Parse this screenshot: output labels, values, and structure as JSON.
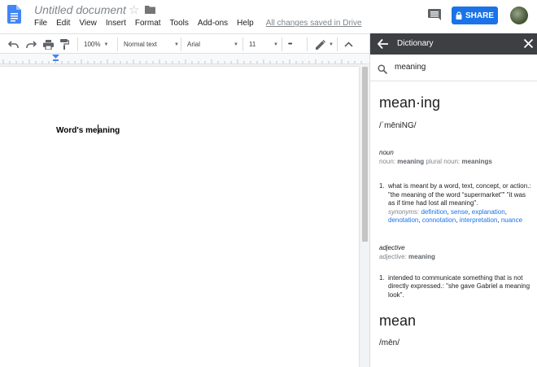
{
  "colors": {
    "brand_blue": "#4285f4",
    "share_blue": "#1a73e8",
    "panel_header": "#3c4043",
    "link": "#1a73e8"
  },
  "header": {
    "doc_title": "Untitled document",
    "menus": [
      "File",
      "Edit",
      "View",
      "Insert",
      "Format",
      "Tools",
      "Add-ons",
      "Help"
    ],
    "save_status": "All changes saved in Drive",
    "share_label": "SHARE",
    "icons": [
      "docs-logo-icon",
      "star-icon",
      "folder-icon",
      "comment-icon",
      "lock-icon",
      "avatar"
    ]
  },
  "toolbar": {
    "zoom": "100%",
    "style": "Normal text",
    "font": "Arial",
    "size": "11",
    "more": "•••",
    "icons": [
      "undo-icon",
      "redo-icon",
      "print-icon",
      "paint-format-icon",
      "pencil-icon",
      "collapse-icon"
    ]
  },
  "document": {
    "text_before_cursor": "Word's me",
    "text_after_cursor": "aning"
  },
  "dictionary": {
    "title": "Dictionary",
    "query": "meaning",
    "headword": "mean·ing",
    "pronunciation": "/ˈmēniNG/",
    "senses": [
      {
        "pos": "noun",
        "forms_prefix": "noun:",
        "forms_base": "meaning",
        "forms_mid": "plural noun:",
        "forms_plural": "meanings",
        "defs": [
          {
            "n": "1.",
            "text": "what is meant by a word, text, concept, or action.: \"the meaning of the word “supermarket”\" \"it was as if time had lost all meaning\".",
            "syn_label": "synonyms:",
            "synonyms": [
              "definition",
              "sense",
              "explanation",
              "denotation",
              "connotation",
              "interpretation",
              "nuance"
            ]
          }
        ]
      },
      {
        "pos": "adjective",
        "forms_prefix": "adjective:",
        "forms_base": "meaning",
        "defs": [
          {
            "n": "1.",
            "text": "intended to communicate something that is not directly expressed.: \"she gave Gabriel a meaning look\"."
          }
        ]
      }
    ],
    "next_headword": "mean",
    "next_pronunciation": "/mēn/"
  }
}
